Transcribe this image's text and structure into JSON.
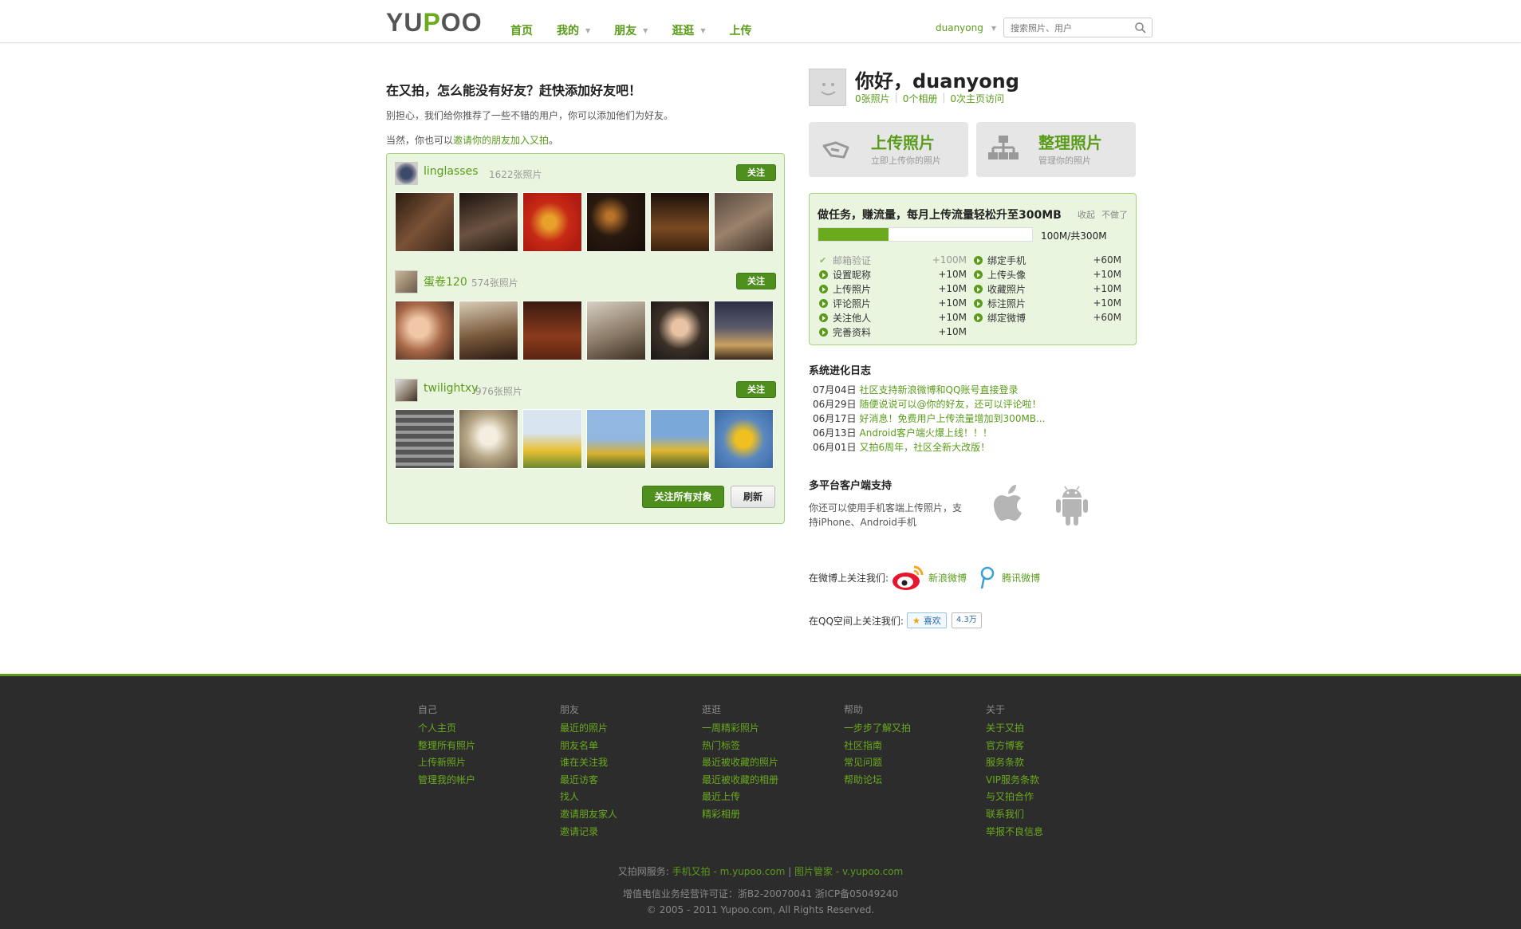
{
  "header": {
    "logo": "YUPOO",
    "nav": [
      {
        "label": "首页",
        "caret": false
      },
      {
        "label": "我的",
        "caret": true
      },
      {
        "label": "朋友",
        "caret": true
      },
      {
        "label": "逛逛",
        "caret": true
      },
      {
        "label": "上传",
        "caret": false
      }
    ],
    "username": "duanyong",
    "search_placeholder": "搜索照片、用户"
  },
  "left": {
    "heading": "在又拍，怎么能没有好友？赶快添加好友吧！",
    "desc": "别担心，我们给你推荐了一些不错的用户，你可以添加他们为好友。",
    "invite_prefix": "当然，你也可以",
    "invite_link": "邀请你的朋友加入又拍",
    "invite_suffix": "。",
    "follow_label": "关注",
    "users": [
      {
        "name": "linglasses",
        "count": "1622张照片"
      },
      {
        "name": "蛋卷120",
        "count": "574张照片"
      },
      {
        "name": "twilightxy",
        "count": "976张照片"
      }
    ],
    "follow_all": "关注所有对象",
    "refresh": "刷新"
  },
  "right": {
    "greeting": "你好，duanyong",
    "stats": [
      "0张照片",
      "0个相册",
      "0次主页访问"
    ],
    "upload": {
      "title": "上传照片",
      "sub": "立即上传你的照片"
    },
    "organize": {
      "title": "整理照片",
      "sub": "管理你的照片"
    },
    "task": {
      "title": "做任务，赚流量，每月上传流量轻松升至300MB",
      "collapse": "收起",
      "skip": "不做了",
      "progress_fraction": 0.33,
      "progress_text": "100M/共300M",
      "left_items": [
        {
          "label": "邮箱验证",
          "pts": "+100M",
          "done": true
        },
        {
          "label": "设置昵称",
          "pts": "+10M",
          "done": false
        },
        {
          "label": "上传照片",
          "pts": "+10M",
          "done": false
        },
        {
          "label": "评论照片",
          "pts": "+10M",
          "done": false
        },
        {
          "label": "关注他人",
          "pts": "+10M",
          "done": false
        },
        {
          "label": "完善资料",
          "pts": "+10M",
          "done": false
        }
      ],
      "right_items": [
        {
          "label": "绑定手机",
          "pts": "+60M",
          "done": false
        },
        {
          "label": "上传头像",
          "pts": "+10M",
          "done": false
        },
        {
          "label": "收藏照片",
          "pts": "+10M",
          "done": false
        },
        {
          "label": "标注照片",
          "pts": "+10M",
          "done": false
        },
        {
          "label": "绑定微博",
          "pts": "+60M",
          "done": false
        }
      ]
    },
    "log_title": "系统进化日志",
    "log": [
      {
        "date": "07月04日",
        "text": "社区支持新浪微博和QQ账号直接登录"
      },
      {
        "date": "06月29日",
        "text": "随便说说可以@你的好友，还可以评论啦！"
      },
      {
        "date": "06月17日",
        "text": "好消息！免费用户上传流量增加到300MB..."
      },
      {
        "date": "06月13日",
        "text": "Android客户端火爆上线！！！"
      },
      {
        "date": "06月01日",
        "text": "又拍6周年，社区全新大改版！"
      }
    ],
    "platform_title": "多平台客户端支持",
    "platform_desc": "你还可以使用手机客端上传照片，支持iPhone、Android手机",
    "weibo_label": "在微博上关注我们:",
    "sina": "新浪微博",
    "tencent": "腾讯微博",
    "qq_label": "在QQ空间上关注我们:",
    "like": "喜欢",
    "like_count": "4.3万"
  },
  "footer": {
    "columns": [
      {
        "title": "自己",
        "links": [
          "个人主页",
          "整理所有照片",
          "上传新照片",
          "管理我的帐户"
        ]
      },
      {
        "title": "朋友",
        "links": [
          "最近的照片",
          "朋友名单",
          "谁在关注我",
          "最近访客",
          "找人",
          "邀请朋友家人",
          "邀请记录"
        ]
      },
      {
        "title": "逛逛",
        "links": [
          "一周精彩照片",
          "热门标签",
          "最近被收藏的照片",
          "最近被收藏的相册",
          "最近上传",
          "精彩相册"
        ]
      },
      {
        "title": "帮助",
        "links": [
          "一步步了解又拍",
          "社区指南",
          "常见问题",
          "帮助论坛"
        ]
      },
      {
        "title": "关于",
        "links": [
          "关于又拍",
          "官方博客",
          "服务条款",
          "VIP服务条款",
          "与又拍合作",
          "联系我们",
          "举报不良信息"
        ]
      }
    ],
    "services_prefix": "又拍网服务:",
    "service_mobile": "手机又拍 - m.yupoo.com",
    "service_sep": "|",
    "service_v": "图片管家 - v.yupoo.com",
    "license": "增值电信业务经营许可证：浙B2-20070041 浙ICP备05049240",
    "copyright": "© 2005 - 2011 Yupoo.com, All Rights Reserved."
  }
}
